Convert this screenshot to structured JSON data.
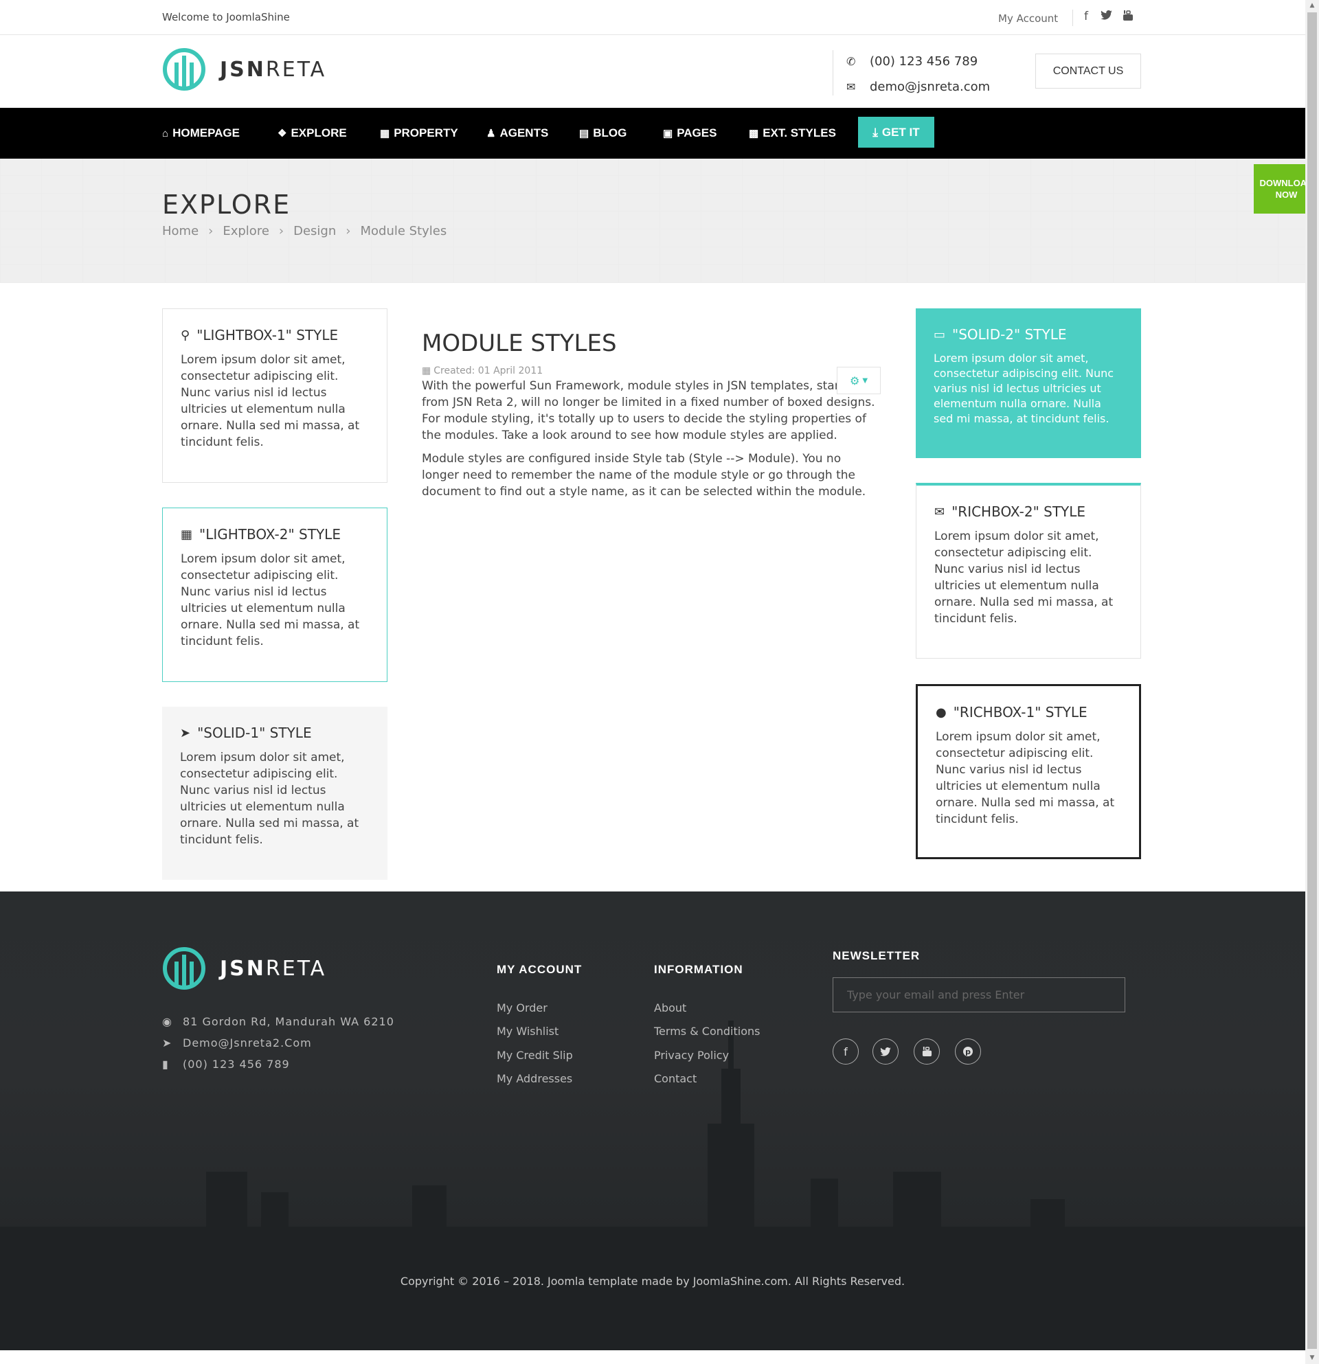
{
  "topbar": {
    "welcome": "Welcome to JoomlaShine",
    "my_account": "My Account",
    "social": [
      "facebook-icon",
      "twitter-icon",
      "youtube-icon"
    ]
  },
  "header": {
    "logo_bold": "JSN",
    "logo_light": "RETA",
    "phone": "(00) 123 456 789",
    "email": "demo@jsnreta.com",
    "contact_button": "CONTACT US"
  },
  "nav": {
    "items": [
      {
        "label": "HOMEPAGE",
        "icon": "home-icon"
      },
      {
        "label": "EXPLORE",
        "icon": "cubes-icon"
      },
      {
        "label": "PROPERTY",
        "icon": "building-icon"
      },
      {
        "label": "AGENTS",
        "icon": "user-icon"
      },
      {
        "label": "BLOG",
        "icon": "newspaper-icon"
      },
      {
        "label": "PAGES",
        "icon": "file-icon"
      },
      {
        "label": "EXT. STYLES",
        "icon": "qrcode-icon"
      }
    ],
    "get_it": "GET IT"
  },
  "page_heading": {
    "title": "EXPLORE",
    "breadcrumbs": [
      "Home",
      "Explore",
      "Design",
      "Module Styles"
    ]
  },
  "download_tab": {
    "line1": "DOWNLOAD",
    "line2": "NOW"
  },
  "modules": {
    "lightbox1": {
      "title": "\"LIGHTBOX-1\" STYLE",
      "text": "Lorem ipsum dolor sit amet, consectetur adipiscing elit. Nunc varius nisl id lectus ultricies ut elementum nulla ornare. Nulla sed mi massa, at tincidunt felis."
    },
    "lightbox2": {
      "title": "\"LIGHTBOX-2\" STYLE",
      "text": "Lorem ipsum dolor sit amet, consectetur adipiscing elit. Nunc varius nisl id lectus ultricies ut elementum nulla ornare. Nulla sed mi massa, at tincidunt felis."
    },
    "solid1": {
      "title": "\"SOLID-1\" STYLE",
      "text": "Lorem ipsum dolor sit amet, consectetur adipiscing elit. Nunc varius nisl id lectus ultricies ut elementum nulla ornare. Nulla sed mi massa, at tincidunt felis."
    },
    "solid2": {
      "title": "\"SOLID-2\" STYLE",
      "text": "Lorem ipsum dolor sit amet, consectetur adipiscing elit. Nunc varius nisl id lectus ultricies ut elementum nulla ornare. Nulla sed mi massa, at tincidunt felis."
    },
    "richbox2": {
      "title": "\"RICHBOX-2\" STYLE",
      "text": "Lorem ipsum dolor sit amet, consectetur adipiscing elit. Nunc varius nisl id lectus ultricies ut elementum nulla ornare. Nulla sed mi massa, at tincidunt felis."
    },
    "richbox1": {
      "title": "\"RICHBOX-1\" STYLE",
      "text": "Lorem ipsum dolor sit amet, consectetur adipiscing elit. Nunc varius nisl id lectus ultricies ut elementum nulla ornare. Nulla sed mi massa, at tincidunt felis."
    }
  },
  "article": {
    "title": "MODULE STYLES",
    "created": "Created: 01 April 2011",
    "p1": "With the powerful Sun Framework, module styles in JSN templates, starting from JSN Reta 2, will no longer be limited in a fixed number of boxed designs. For module styling, it's totally up to users to decide the styling properties of the modules. Take a look around to see how module styles are applied.",
    "p2": "Module styles are configured inside Style tab (Style --> Module). You no longer need to remember the name of the module style or go through the document to find out a style name, as it can be selected within the module."
  },
  "footer": {
    "logo_bold": "JSN",
    "logo_light": "RETA",
    "address": "81 Gordon Rd, Mandurah WA 6210",
    "email": "Demo@Jsnreta2.Com",
    "phone": "(00) 123 456 789",
    "my_account_title": "MY ACCOUNT",
    "my_account_links": [
      "My Order",
      "My Wishlist",
      "My Credit Slip",
      "My Addresses"
    ],
    "information_title": "INFORMATION",
    "information_links": [
      "About",
      "Terms & Conditions",
      "Privacy Policy",
      "Contact"
    ],
    "newsletter_title": "NEWSLETTER",
    "newsletter_placeholder": "Type your email and press Enter",
    "social": [
      "facebook-icon",
      "twitter-icon",
      "youtube-icon",
      "pinterest-icon"
    ],
    "copyright": "Copyright © 2016 – 2018. Joomla template made by JoomlaShine.com. All Rights Reserved."
  },
  "colors": {
    "accent": "#3cc6b7",
    "download": "#6fbf1d",
    "nav_bg": "#000000",
    "footer_bg": "#2a2d2f"
  }
}
